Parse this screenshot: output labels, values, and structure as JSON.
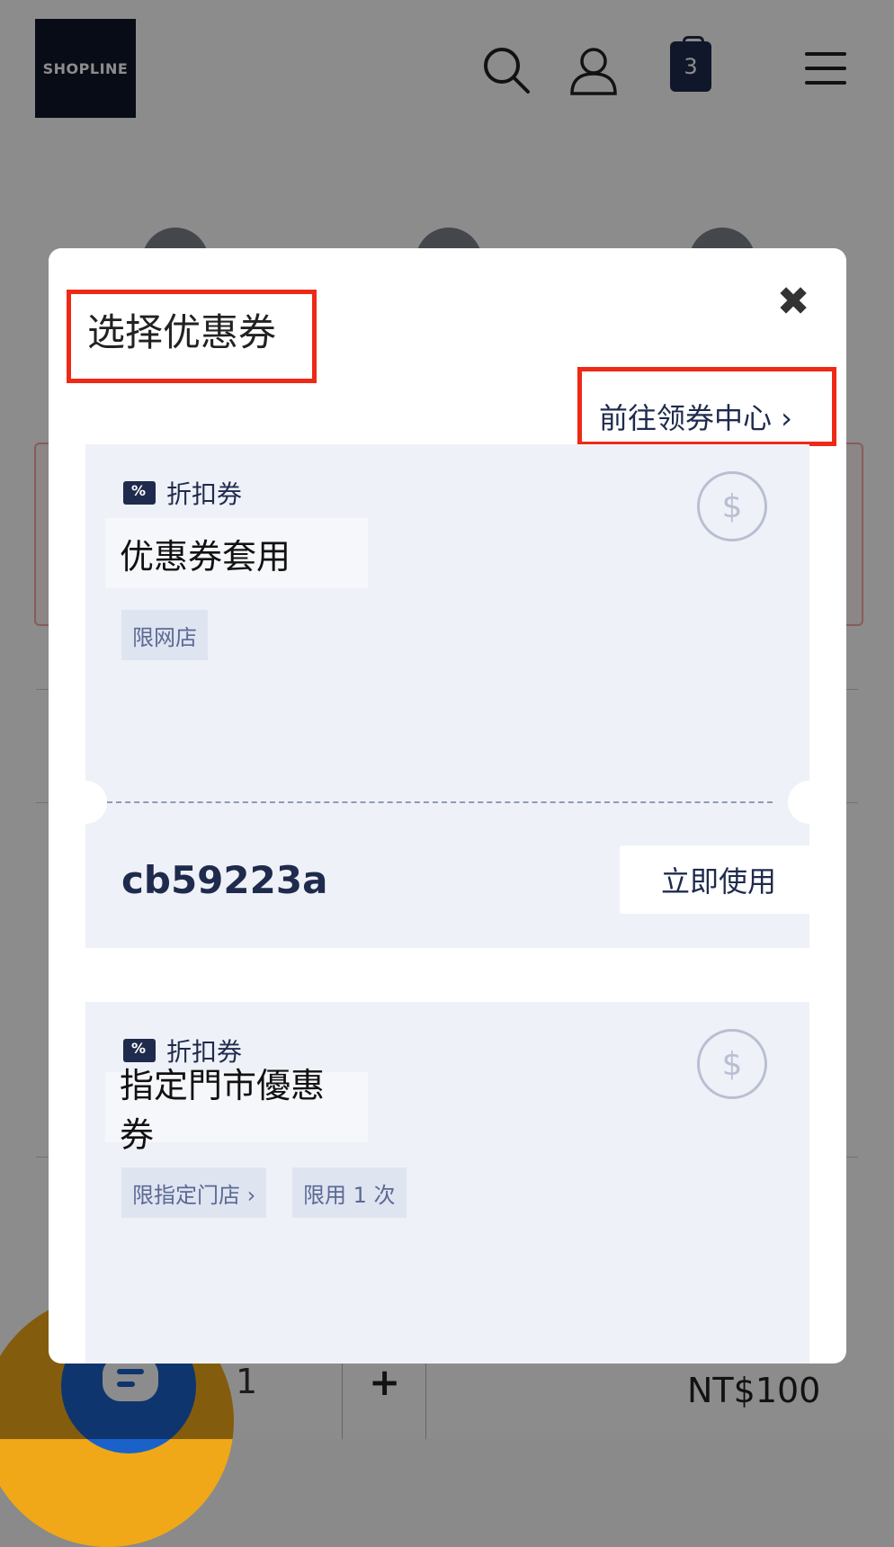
{
  "header": {
    "logo_text": "SHOPLINE",
    "cart_count": "3",
    "icons": [
      "search-icon",
      "user-icon",
      "cart-icon",
      "menu-icon"
    ]
  },
  "background": {
    "quantity": "1",
    "plus": "+",
    "price": "NT$100"
  },
  "modal": {
    "title": "选择优惠券",
    "close_symbol": "✖",
    "coupon_center_link": "前往领券中心 ›",
    "coupons": [
      {
        "type": "折扣券",
        "name": "优惠券套用",
        "tags": [
          "限网店"
        ],
        "code": "cb59223a",
        "use_label": "立即使用",
        "currency_symbol": "$"
      },
      {
        "type": "折扣券",
        "name": "指定門市優惠券",
        "tags": [
          "限指定门店 ›",
          "限用 1 次"
        ],
        "currency_symbol": "$"
      }
    ]
  },
  "colors": {
    "brand_navy": "#1f2b4d",
    "highlight_red": "#ee2a17",
    "coupon_bg": "#eff1f8",
    "chat_orange": "#f0a818",
    "chat_blue": "#1a62c9"
  }
}
